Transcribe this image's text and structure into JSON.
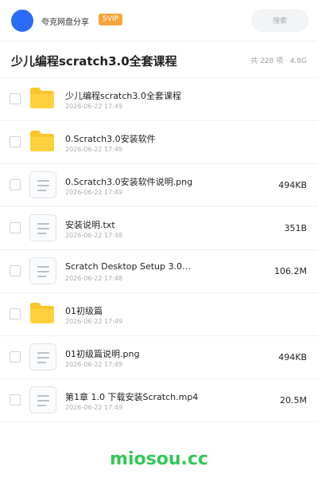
{
  "header": {
    "app_name": "夸克网盘分享",
    "badge": "SVIP",
    "search_placeholder": "搜索"
  },
  "title": {
    "text": "少儿编程scratch3.0全套课程",
    "meta": "共 228 项 · 4.8G"
  },
  "colors": {
    "avatar": "#2b6cf6",
    "badge": "#f7a53a",
    "folder": "#fcc52d",
    "brand": "#34c759"
  },
  "items": [
    {
      "name": "少儿编程scratch3.0全套课程",
      "date": "2026-06-22 17:49",
      "size": "",
      "type": "folder",
      "icon": "folder-icon"
    },
    {
      "name": "0.Scratch3.0安装软件",
      "date": "2026-06-22 17:49",
      "size": "",
      "type": "folder",
      "icon": "folder-icon"
    },
    {
      "name": "0.Scratch3.0安装软件说明.png",
      "date": "2026-06-22 17:49",
      "size": "494KB",
      "type": "file",
      "icon": "file-icon"
    },
    {
      "name": "安装说明.txt",
      "date": "2026-06-22 17:48",
      "size": "351B",
      "type": "file",
      "icon": "file-icon"
    },
    {
      "name": "Scratch Desktop Setup 3.0…",
      "date": "2026-06-22 17:48",
      "size": "106.2M",
      "type": "file",
      "icon": "file-icon"
    },
    {
      "name": "01初级篇",
      "date": "2026-06-22 17:49",
      "size": "",
      "type": "folder",
      "icon": "folder-icon"
    },
    {
      "name": "01初级篇说明.png",
      "date": "2026-06-22 17:49",
      "size": "494KB",
      "type": "file",
      "icon": "file-icon"
    },
    {
      "name": "第1章 1.0 下载安装Scratch.mp4",
      "date": "2026-06-22 17:49",
      "size": "20.5M",
      "type": "file",
      "icon": "file-icon"
    }
  ],
  "footer": {
    "brand": "miosou.cc"
  }
}
